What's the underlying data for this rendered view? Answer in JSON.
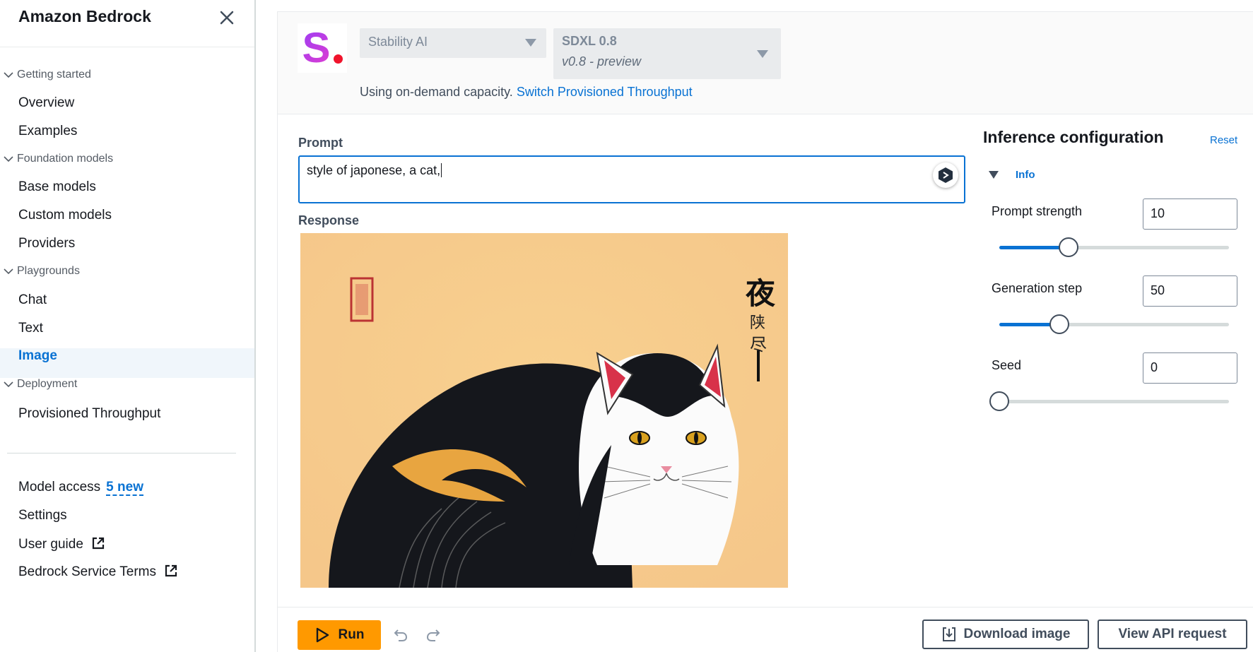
{
  "sidebar": {
    "title": "Amazon Bedrock",
    "sections": [
      {
        "label": "Getting started",
        "items": [
          "Overview",
          "Examples"
        ]
      },
      {
        "label": "Foundation models",
        "items": [
          "Base models",
          "Custom models",
          "Providers"
        ]
      },
      {
        "label": "Playgrounds",
        "items": [
          "Chat",
          "Text",
          "Image"
        ]
      },
      {
        "label": "Deployment",
        "items": [
          "Provisioned Throughput"
        ]
      }
    ],
    "active_item": "Image",
    "bottom": {
      "model_access": "Model access",
      "model_access_badge": "5 new",
      "settings": "Settings",
      "user_guide": "User guide",
      "service_terms": "Bedrock Service Terms"
    }
  },
  "header": {
    "provider_select": "Stability AI",
    "model_select_name": "SDXL 0.8",
    "model_select_version": "v0.8 - preview",
    "capacity_text": "Using on-demand capacity.",
    "capacity_link": "Switch Provisioned Throughput"
  },
  "main": {
    "prompt_label": "Prompt",
    "prompt_value": "style of japonese, a cat,",
    "response_label": "Response",
    "response_image_text": [
      "夜",
      "陕",
      "尽"
    ]
  },
  "inference": {
    "title": "Inference configuration",
    "reset": "Reset",
    "info": "Info",
    "params": [
      {
        "label": "Prompt strength",
        "value": "10",
        "fraction": 0.3
      },
      {
        "label": "Generation step",
        "value": "50",
        "fraction": 0.26
      },
      {
        "label": "Seed",
        "value": "0",
        "fraction": 0.0
      }
    ]
  },
  "footer": {
    "run": "Run",
    "download": "Download image",
    "view_api": "View API request"
  },
  "colors": {
    "accent": "#0972d3",
    "run_button": "#ff9900",
    "active_nav_bg": "#f0f6fb"
  },
  "icons": [
    "close-icon",
    "chevron-down-icon",
    "external-link-icon",
    "play-icon",
    "undo-icon",
    "redo-icon",
    "download-icon",
    "prompt-assist-icon"
  ]
}
